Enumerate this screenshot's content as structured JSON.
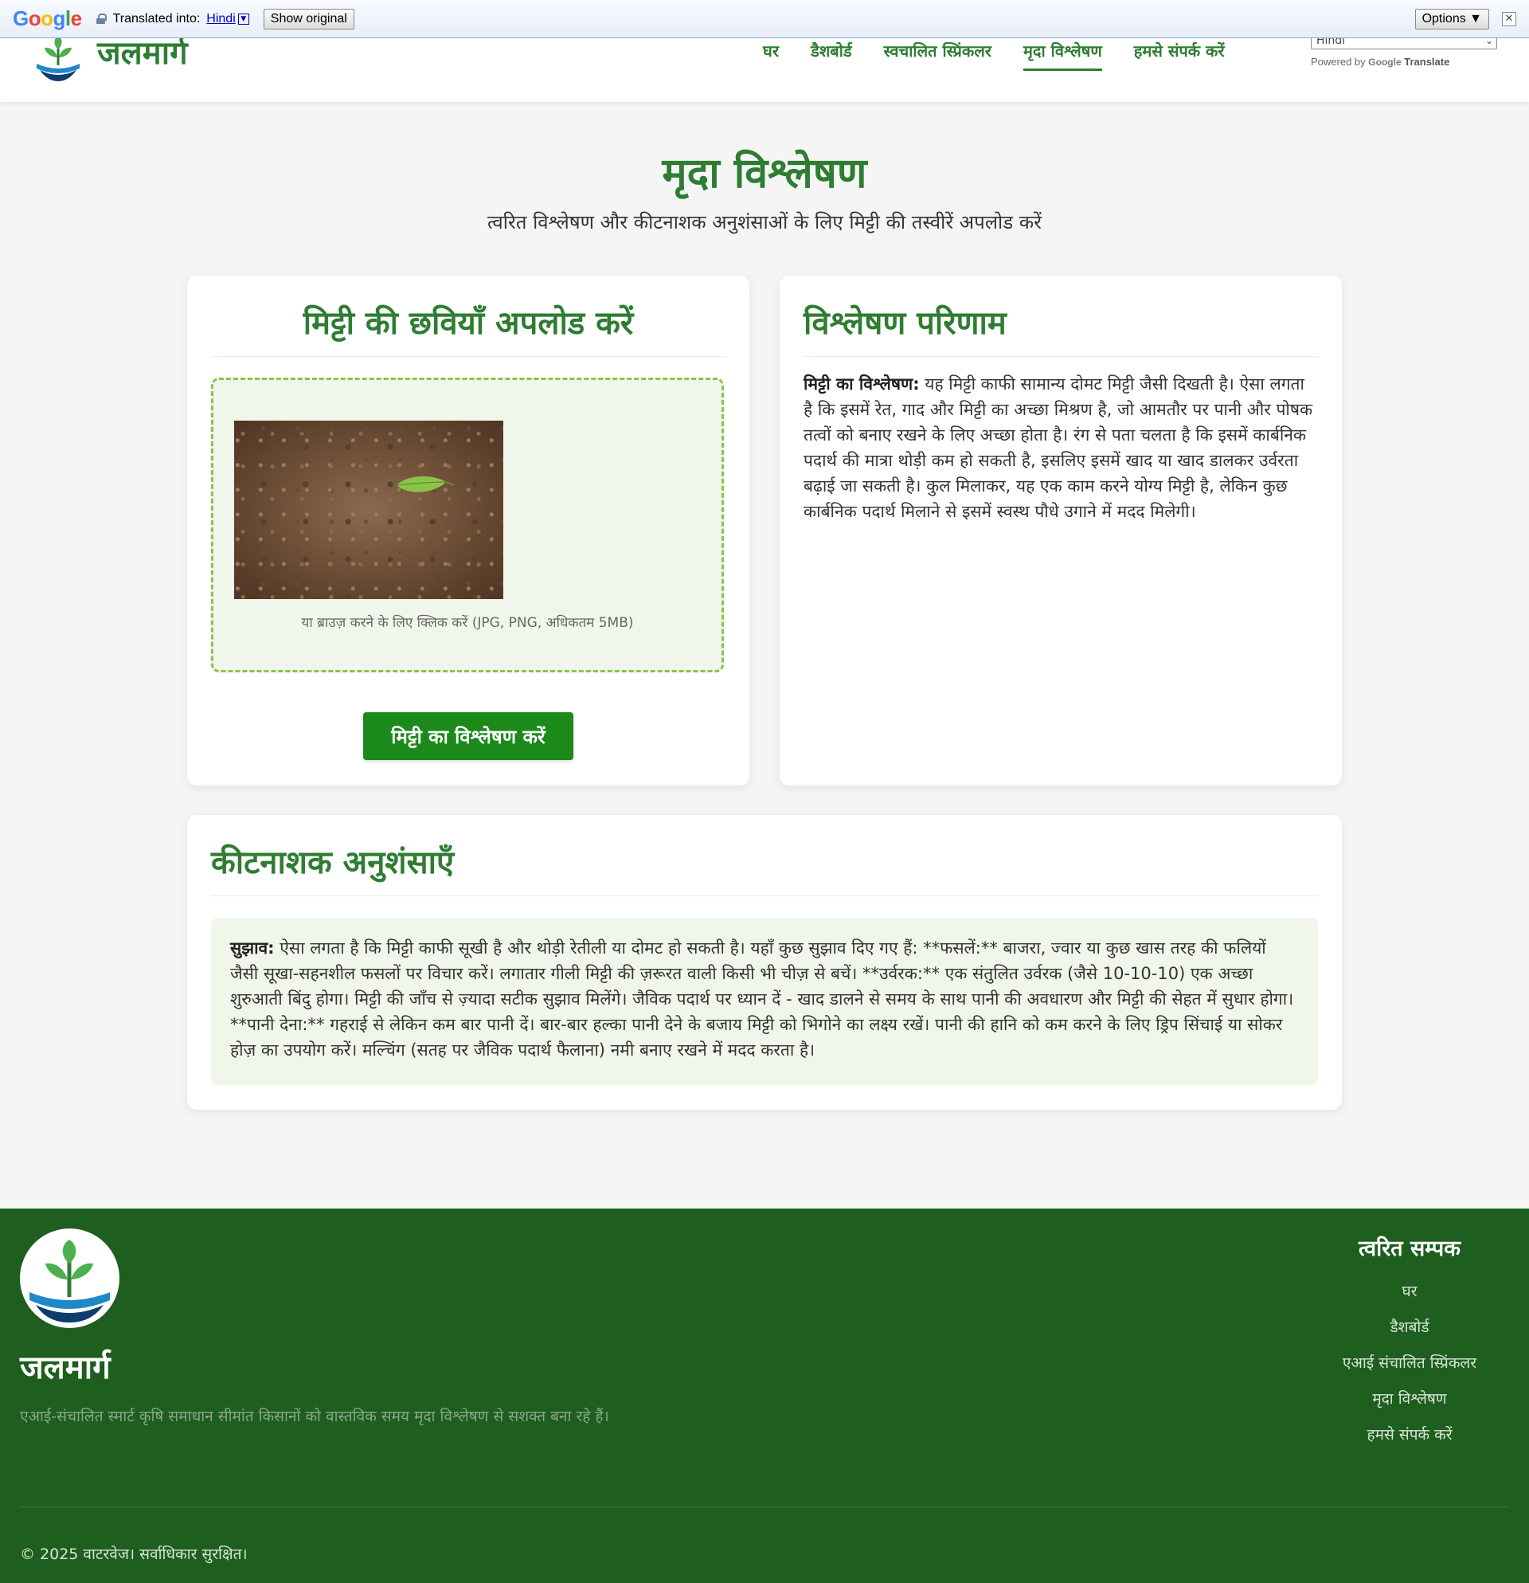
{
  "translate_bar": {
    "logo": [
      "G",
      "o",
      "o",
      "g",
      "l",
      "e"
    ],
    "translated_into": "Translated into:",
    "language": "Hindi",
    "show_original": "Show original",
    "options": "Options ▼",
    "close": "✕"
  },
  "header": {
    "brand_name": "जलमार्ग",
    "nav": [
      "घर",
      "डैशबोर्ड",
      "स्वचालित स्प्रिंकलर",
      "मृदा विश्लेषण",
      "हमसे संपर्क करें"
    ],
    "active_nav_index": 3,
    "language_select": "Hindi",
    "powered_by": "Powered by",
    "powered_google": "Google",
    "powered_translate": "Translate"
  },
  "hero": {
    "title": "मृदा विश्लेषण",
    "subtitle": "त्वरित विश्लेषण और कीटनाशक अनुशंसाओं के लिए मिट्टी की तस्वीरें अपलोड करें"
  },
  "upload": {
    "title": "मिट्टी की छवियाँ अपलोड करें",
    "hint": "या ब्राउज़ करने के लिए क्लिक करें (JPG, PNG, अधिकतम 5MB)",
    "button": "मिट्टी का विश्लेषण करें"
  },
  "results": {
    "title": "विश्लेषण परिणाम",
    "label": "मिट्टी का विश्लेषण:",
    "text": " यह मिट्टी काफी सामान्य दोमट मिट्टी जैसी दिखती है। ऐसा लगता है कि इसमें रेत, गाद और मिट्टी का अच्छा मिश्रण है, जो आमतौर पर पानी और पोषक तत्वों को बनाए रखने के लिए अच्छा होता है। रंग से पता चलता है कि इसमें कार्बनिक पदार्थ की मात्रा थोड़ी कम हो सकती है, इसलिए इसमें खाद या खाद डालकर उर्वरता बढ़ाई जा सकती है। कुल मिलाकर, यह एक काम करने योग्य मिट्टी है, लेकिन कुछ कार्बनिक पदार्थ मिलाने से इसमें स्वस्थ पौधे उगाने में मदद मिलेगी।"
  },
  "pesticide": {
    "title": "कीटनाशक अनुशंसाएँ",
    "label": "सुझाव:",
    "text": " ऐसा लगता है कि मिट्टी काफी सूखी है और थोड़ी रेतीली या दोमट हो सकती है। यहाँ कुछ सुझाव दिए गए हैं: **फसलें:** बाजरा, ज्वार या कुछ खास तरह की फलियों जैसी सूखा-सहनशील फसलों पर विचार करें। लगातार गीली मिट्टी की ज़रूरत वाली किसी भी चीज़ से बचें। **उर्वरक:** एक संतुलित उर्वरक (जैसे 10-10-10) एक अच्छा शुरुआती बिंदु होगा। मिट्टी की जाँच से ज़्यादा सटीक सुझाव मिलेंगे। जैविक पदार्थ पर ध्यान दें - खाद डालने से समय के साथ पानी की अवधारण और मिट्टी की सेहत में सुधार होगा। **पानी देना:** गहराई से लेकिन कम बार पानी दें। बार-बार हल्का पानी देने के बजाय मिट्टी को भिगोने का लक्ष्य रखें। पानी की हानि को कम करने के लिए ड्रिप सिंचाई या सोकर होज़ का उपयोग करें। मल्चिंग (सतह पर जैविक पदार्थ फैलाना) नमी बनाए रखने में मदद करता है।"
  },
  "footer": {
    "brand": "जलमार्ग",
    "tagline": "एआई-संचालित स्मार्ट कृषि समाधान सीमांत किसानों को वास्तविक समय मृदा विश्लेषण से सशक्त बना रहे हैं।",
    "links_title": "त्वरित सम्पक",
    "links": [
      "घर",
      "डैशबोर्ड",
      "एआई संचालित स्प्रिंकलर",
      "मृदा विश्लेषण",
      "हमसे संपर्क करें"
    ],
    "copyright": "© 2025 वाटरवेज। सर्वाधिकार सुरक्षित।"
  },
  "colors": {
    "primary_green": "#2e7d32",
    "button_green": "#1b8a1b",
    "footer_green": "#1e5e1e",
    "dropzone_border": "#8bc34a",
    "light_panel": "#f1f6ea"
  }
}
